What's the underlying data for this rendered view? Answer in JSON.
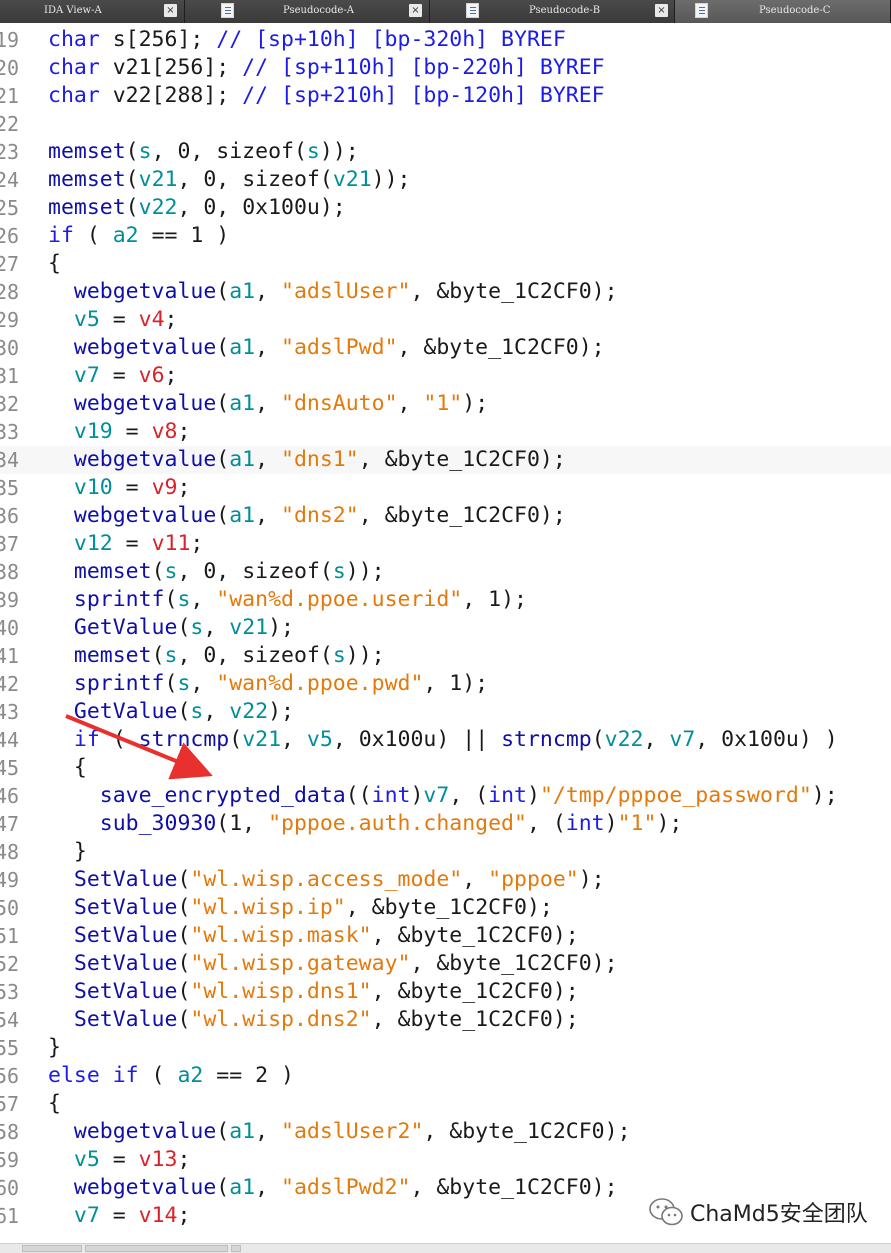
{
  "tabs": [
    {
      "label": "IDA View-A",
      "active": false
    },
    {
      "label": "Pseudocode-A",
      "active": false
    },
    {
      "label": "Pseudocode-B",
      "active": false
    },
    {
      "label": "Pseudocode-C",
      "active": true
    }
  ],
  "tab_close_glyph": "×",
  "colors": {
    "keyword": "#1c1ce6",
    "variable": "#008f9a",
    "local": "#d8232a",
    "string": "#e37a0b",
    "arrow": "#e8312f"
  },
  "code_lines": [
    {
      "ln": "19",
      "tokens": [
        [
          "kw",
          "char"
        ],
        [
          "txt",
          " s[256]; "
        ],
        [
          "cm",
          "// [sp+10h] [bp-320h] BYREF"
        ]
      ]
    },
    {
      "ln": "20",
      "tokens": [
        [
          "kw",
          "char"
        ],
        [
          "txt",
          " v21[256]; "
        ],
        [
          "cm",
          "// [sp+110h] [bp-220h] BYREF"
        ]
      ]
    },
    {
      "ln": "21",
      "tokens": [
        [
          "kw",
          "char"
        ],
        [
          "txt",
          " v22[288]; "
        ],
        [
          "cm",
          "// [sp+210h] [bp-120h] BYREF"
        ]
      ]
    },
    {
      "ln": "22",
      "tokens": []
    },
    {
      "ln": "23",
      "tokens": [
        [
          "fn",
          "memset"
        ],
        [
          "txt",
          "("
        ],
        [
          "var",
          "s"
        ],
        [
          "txt",
          ", 0, sizeof("
        ],
        [
          "var",
          "s"
        ],
        [
          "txt",
          "));"
        ]
      ]
    },
    {
      "ln": "24",
      "tokens": [
        [
          "fn",
          "memset"
        ],
        [
          "txt",
          "("
        ],
        [
          "var",
          "v21"
        ],
        [
          "txt",
          ", 0, sizeof("
        ],
        [
          "var",
          "v21"
        ],
        [
          "txt",
          "));"
        ]
      ]
    },
    {
      "ln": "25",
      "tokens": [
        [
          "fn",
          "memset"
        ],
        [
          "txt",
          "("
        ],
        [
          "var",
          "v22"
        ],
        [
          "txt",
          ", 0, 0x100u);"
        ]
      ]
    },
    {
      "ln": "26",
      "tokens": [
        [
          "kw",
          "if"
        ],
        [
          "txt",
          " ( "
        ],
        [
          "var",
          "a2"
        ],
        [
          "txt",
          " == 1 )"
        ]
      ]
    },
    {
      "ln": "27",
      "tokens": [
        [
          "txt",
          "{"
        ]
      ]
    },
    {
      "ln": "28",
      "tokens": [
        [
          "txt",
          "  "
        ],
        [
          "fn",
          "webgetvalue"
        ],
        [
          "txt",
          "("
        ],
        [
          "var",
          "a1"
        ],
        [
          "txt",
          ", "
        ],
        [
          "str",
          "\"adslUser\""
        ],
        [
          "txt",
          ", &byte_1C2CF0);"
        ]
      ]
    },
    {
      "ln": "29",
      "tokens": [
        [
          "txt",
          "  "
        ],
        [
          "var",
          "v5"
        ],
        [
          "txt",
          " = "
        ],
        [
          "loc",
          "v4"
        ],
        [
          "txt",
          ";"
        ]
      ]
    },
    {
      "ln": "30",
      "tokens": [
        [
          "txt",
          "  "
        ],
        [
          "fn",
          "webgetvalue"
        ],
        [
          "txt",
          "("
        ],
        [
          "var",
          "a1"
        ],
        [
          "txt",
          ", "
        ],
        [
          "str",
          "\"adslPwd\""
        ],
        [
          "txt",
          ", &byte_1C2CF0);"
        ]
      ]
    },
    {
      "ln": "31",
      "tokens": [
        [
          "txt",
          "  "
        ],
        [
          "var",
          "v7"
        ],
        [
          "txt",
          " = "
        ],
        [
          "loc",
          "v6"
        ],
        [
          "txt",
          ";"
        ]
      ]
    },
    {
      "ln": "32",
      "tokens": [
        [
          "txt",
          "  "
        ],
        [
          "fn",
          "webgetvalue"
        ],
        [
          "txt",
          "("
        ],
        [
          "var",
          "a1"
        ],
        [
          "txt",
          ", "
        ],
        [
          "str",
          "\"dnsAuto\""
        ],
        [
          "txt",
          ", "
        ],
        [
          "str",
          "\"1\""
        ],
        [
          "txt",
          ");"
        ]
      ]
    },
    {
      "ln": "33",
      "tokens": [
        [
          "txt",
          "  "
        ],
        [
          "var",
          "v19"
        ],
        [
          "txt",
          " = "
        ],
        [
          "loc",
          "v8"
        ],
        [
          "txt",
          ";"
        ]
      ]
    },
    {
      "ln": "34",
      "hl": true,
      "tokens": [
        [
          "txt",
          "  "
        ],
        [
          "fn",
          "webgetvalue"
        ],
        [
          "txt",
          "("
        ],
        [
          "var",
          "a1"
        ],
        [
          "txt",
          ", "
        ],
        [
          "str",
          "\"dns1\""
        ],
        [
          "txt",
          ", &byte_1C2CF0);"
        ]
      ]
    },
    {
      "ln": "35",
      "tokens": [
        [
          "txt",
          "  "
        ],
        [
          "var",
          "v10"
        ],
        [
          "txt",
          " = "
        ],
        [
          "loc",
          "v9"
        ],
        [
          "txt",
          ";"
        ]
      ]
    },
    {
      "ln": "36",
      "tokens": [
        [
          "txt",
          "  "
        ],
        [
          "fn",
          "webgetvalue"
        ],
        [
          "txt",
          "("
        ],
        [
          "var",
          "a1"
        ],
        [
          "txt",
          ", "
        ],
        [
          "str",
          "\"dns2\""
        ],
        [
          "txt",
          ", &byte_1C2CF0);"
        ]
      ]
    },
    {
      "ln": "37",
      "tokens": [
        [
          "txt",
          "  "
        ],
        [
          "var",
          "v12"
        ],
        [
          "txt",
          " = "
        ],
        [
          "loc",
          "v11"
        ],
        [
          "txt",
          ";"
        ]
      ]
    },
    {
      "ln": "38",
      "tokens": [
        [
          "txt",
          "  "
        ],
        [
          "fn",
          "memset"
        ],
        [
          "txt",
          "("
        ],
        [
          "var",
          "s"
        ],
        [
          "txt",
          ", 0, sizeof("
        ],
        [
          "var",
          "s"
        ],
        [
          "txt",
          "));"
        ]
      ]
    },
    {
      "ln": "39",
      "tokens": [
        [
          "txt",
          "  "
        ],
        [
          "fn",
          "sprintf"
        ],
        [
          "txt",
          "("
        ],
        [
          "var",
          "s"
        ],
        [
          "txt",
          ", "
        ],
        [
          "str",
          "\"wan%d.ppoe.userid\""
        ],
        [
          "txt",
          ", 1);"
        ]
      ]
    },
    {
      "ln": "40",
      "tokens": [
        [
          "txt",
          "  "
        ],
        [
          "fn",
          "GetValue"
        ],
        [
          "txt",
          "("
        ],
        [
          "var",
          "s"
        ],
        [
          "txt",
          ", "
        ],
        [
          "var",
          "v21"
        ],
        [
          "txt",
          ");"
        ]
      ]
    },
    {
      "ln": "41",
      "tokens": [
        [
          "txt",
          "  "
        ],
        [
          "fn",
          "memset"
        ],
        [
          "txt",
          "("
        ],
        [
          "var",
          "s"
        ],
        [
          "txt",
          ", 0, sizeof("
        ],
        [
          "var",
          "s"
        ],
        [
          "txt",
          "));"
        ]
      ]
    },
    {
      "ln": "42",
      "tokens": [
        [
          "txt",
          "  "
        ],
        [
          "fn",
          "sprintf"
        ],
        [
          "txt",
          "("
        ],
        [
          "var",
          "s"
        ],
        [
          "txt",
          ", "
        ],
        [
          "str",
          "\"wan%d.ppoe.pwd\""
        ],
        [
          "txt",
          ", 1);"
        ]
      ]
    },
    {
      "ln": "43",
      "tokens": [
        [
          "txt",
          "  "
        ],
        [
          "fn",
          "GetValue"
        ],
        [
          "txt",
          "("
        ],
        [
          "var",
          "s"
        ],
        [
          "txt",
          ", "
        ],
        [
          "var",
          "v22"
        ],
        [
          "txt",
          ");"
        ]
      ]
    },
    {
      "ln": "44",
      "tokens": [
        [
          "txt",
          "  "
        ],
        [
          "kw",
          "if"
        ],
        [
          "txt",
          " ( "
        ],
        [
          "fn",
          "strncmp"
        ],
        [
          "txt",
          "("
        ],
        [
          "var",
          "v21"
        ],
        [
          "txt",
          ", "
        ],
        [
          "var",
          "v5"
        ],
        [
          "txt",
          ", 0x100u) || "
        ],
        [
          "fn",
          "strncmp"
        ],
        [
          "txt",
          "("
        ],
        [
          "var",
          "v22"
        ],
        [
          "txt",
          ", "
        ],
        [
          "var",
          "v7"
        ],
        [
          "txt",
          ", 0x100u) )"
        ]
      ]
    },
    {
      "ln": "45",
      "tokens": [
        [
          "txt",
          "  {"
        ]
      ]
    },
    {
      "ln": "46",
      "tokens": [
        [
          "txt",
          "    "
        ],
        [
          "fn",
          "save_encrypted_data"
        ],
        [
          "txt",
          "(("
        ],
        [
          "kw",
          "int"
        ],
        [
          "txt",
          ")"
        ],
        [
          "var",
          "v7"
        ],
        [
          "txt",
          ", ("
        ],
        [
          "kw",
          "int"
        ],
        [
          "txt",
          ")"
        ],
        [
          "str",
          "\"/tmp/pppoe_password\""
        ],
        [
          "txt",
          ");"
        ]
      ]
    },
    {
      "ln": "47",
      "tokens": [
        [
          "txt",
          "    "
        ],
        [
          "fn",
          "sub_30930"
        ],
        [
          "txt",
          "(1, "
        ],
        [
          "str",
          "\"pppoe.auth.changed\""
        ],
        [
          "txt",
          ", ("
        ],
        [
          "kw",
          "int"
        ],
        [
          "txt",
          ")"
        ],
        [
          "str",
          "\"1\""
        ],
        [
          "txt",
          ");"
        ]
      ]
    },
    {
      "ln": "48",
      "tokens": [
        [
          "txt",
          "  }"
        ]
      ]
    },
    {
      "ln": "49",
      "tokens": [
        [
          "txt",
          "  "
        ],
        [
          "fn",
          "SetValue"
        ],
        [
          "txt",
          "("
        ],
        [
          "str",
          "\"wl.wisp.access_mode\""
        ],
        [
          "txt",
          ", "
        ],
        [
          "str",
          "\"pppoe\""
        ],
        [
          "txt",
          ");"
        ]
      ]
    },
    {
      "ln": "50",
      "tokens": [
        [
          "txt",
          "  "
        ],
        [
          "fn",
          "SetValue"
        ],
        [
          "txt",
          "("
        ],
        [
          "str",
          "\"wl.wisp.ip\""
        ],
        [
          "txt",
          ", &byte_1C2CF0);"
        ]
      ]
    },
    {
      "ln": "51",
      "tokens": [
        [
          "txt",
          "  "
        ],
        [
          "fn",
          "SetValue"
        ],
        [
          "txt",
          "("
        ],
        [
          "str",
          "\"wl.wisp.mask\""
        ],
        [
          "txt",
          ", &byte_1C2CF0);"
        ]
      ]
    },
    {
      "ln": "52",
      "tokens": [
        [
          "txt",
          "  "
        ],
        [
          "fn",
          "SetValue"
        ],
        [
          "txt",
          "("
        ],
        [
          "str",
          "\"wl.wisp.gateway\""
        ],
        [
          "txt",
          ", &byte_1C2CF0);"
        ]
      ]
    },
    {
      "ln": "53",
      "tokens": [
        [
          "txt",
          "  "
        ],
        [
          "fn",
          "SetValue"
        ],
        [
          "txt",
          "("
        ],
        [
          "str",
          "\"wl.wisp.dns1\""
        ],
        [
          "txt",
          ", &byte_1C2CF0);"
        ]
      ]
    },
    {
      "ln": "54",
      "tokens": [
        [
          "txt",
          "  "
        ],
        [
          "fn",
          "SetValue"
        ],
        [
          "txt",
          "("
        ],
        [
          "str",
          "\"wl.wisp.dns2\""
        ],
        [
          "txt",
          ", &byte_1C2CF0);"
        ]
      ]
    },
    {
      "ln": "55",
      "tokens": [
        [
          "txt",
          "}"
        ]
      ]
    },
    {
      "ln": "56",
      "tokens": [
        [
          "kw",
          "else if"
        ],
        [
          "txt",
          " ( "
        ],
        [
          "var",
          "a2"
        ],
        [
          "txt",
          " == 2 )"
        ]
      ]
    },
    {
      "ln": "57",
      "tokens": [
        [
          "txt",
          "{"
        ]
      ]
    },
    {
      "ln": "58",
      "tokens": [
        [
          "txt",
          "  "
        ],
        [
          "fn",
          "webgetvalue"
        ],
        [
          "txt",
          "("
        ],
        [
          "var",
          "a1"
        ],
        [
          "txt",
          ", "
        ],
        [
          "str",
          "\"adslUser2\""
        ],
        [
          "txt",
          ", &byte_1C2CF0);"
        ]
      ]
    },
    {
      "ln": "59",
      "tokens": [
        [
          "txt",
          "  "
        ],
        [
          "var",
          "v5"
        ],
        [
          "txt",
          " = "
        ],
        [
          "loc",
          "v13"
        ],
        [
          "txt",
          ";"
        ]
      ]
    },
    {
      "ln": "60",
      "tokens": [
        [
          "txt",
          "  "
        ],
        [
          "fn",
          "webgetvalue"
        ],
        [
          "txt",
          "("
        ],
        [
          "var",
          "a1"
        ],
        [
          "txt",
          ", "
        ],
        [
          "str",
          "\"adslPwd2\""
        ],
        [
          "txt",
          ", &byte_1C2CF0);"
        ]
      ]
    },
    {
      "ln": "61",
      "tokens": [
        [
          "txt",
          "  "
        ],
        [
          "var",
          "v7"
        ],
        [
          "txt",
          " = "
        ],
        [
          "loc",
          "v14"
        ],
        [
          "txt",
          ";"
        ]
      ]
    }
  ],
  "watermark": {
    "text": "ChaMd5安全团队",
    "icon": "wechat-icon"
  }
}
